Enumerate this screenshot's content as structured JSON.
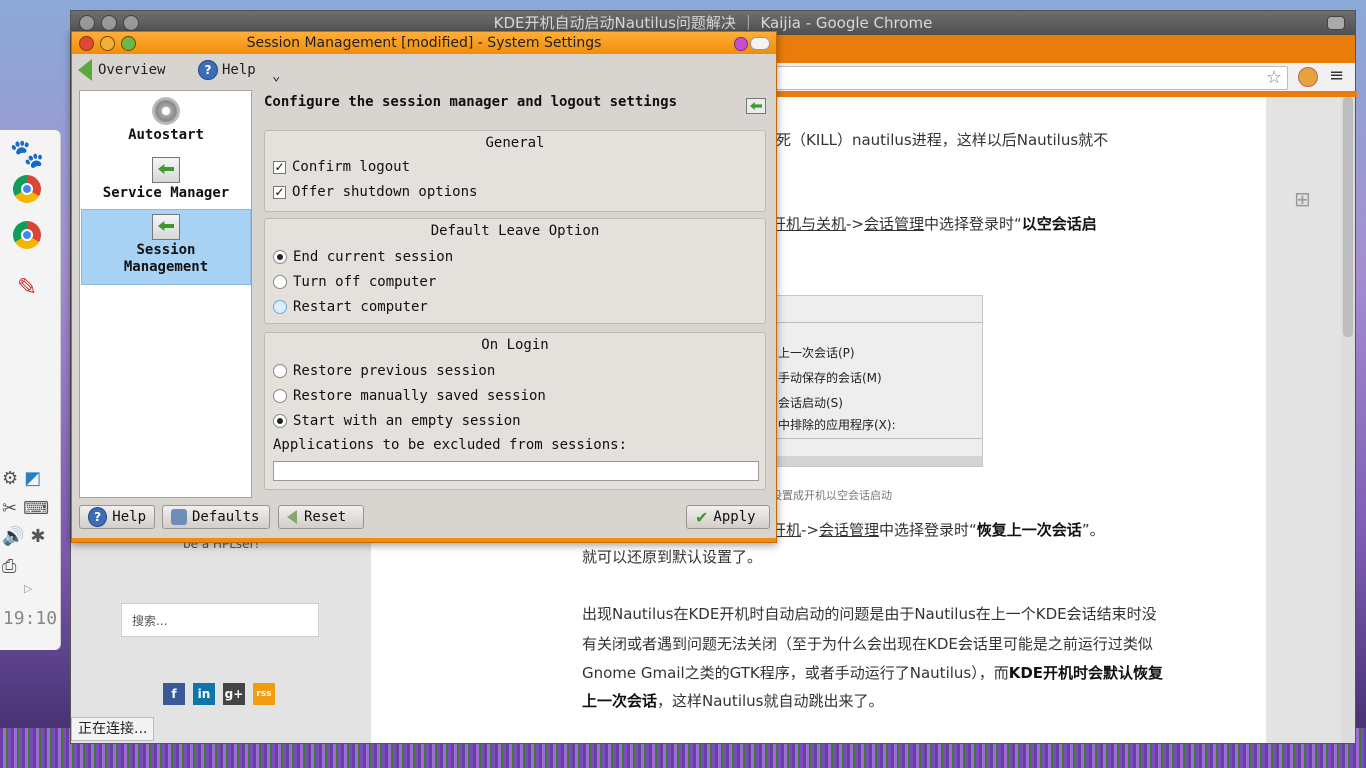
{
  "chrome": {
    "title": "KDE开机自动启动Nautilus问题解决 ｜ Kaijia - Google Chrome",
    "status": "正在连接..."
  },
  "article": {
    "p1": "死（KILL）nautilus进程，这样以后Nautilus就不",
    "p2_a": "开机与关机",
    "p2_b": "->",
    "p2_c": "会话管理",
    "p2_d": "中选择登录时“",
    "p2_e": "以空会话启",
    "shot_lines": [
      "上一次会话(P)",
      "手动保存的会话(M)",
      "会话启动(S)",
      "中排除的应用程序(X):"
    ],
    "caption": "设置成开机以空会话启动",
    "p3_a": "开机",
    "p3_b": "->",
    "p3_c": "会话管理",
    "p3_d": "中选择登录时“",
    "p3_e": "恢复上一次会话",
    "p3_f": "”。",
    "p4": "就可以还原到默认设置了。",
    "p5_l1": "出现Nautilus在KDE开机时自动启动的问题是由于Nautilus在上一个KDE会话结束时没",
    "p5_l2": "有关闭或者遇到问题无法关闭（至于为什么会出现在KDE会话里可能是之前运行过类似",
    "p5_l3a": "Gnome Gmail之类的GTK程序，或者手动运行了Nautilus），而",
    "p5_l3b": "KDE开机时会默认恢复",
    "p5_l4a": "上一次会话",
    "p5_l4b": "，这样Nautilus就自动跳出来了。"
  },
  "sidebar_page": {
    "left_text": "be a HPLser!",
    "search_placeholder": "搜索...",
    "social": [
      "f",
      "in",
      "g+",
      "rss"
    ]
  },
  "dock": {
    "clock": "19:10"
  },
  "dialog": {
    "title": "Session Management [modified] - System Settings",
    "toolbar": {
      "overview": "Overview",
      "help": "Help",
      "more": "⌄"
    },
    "sidebar": [
      {
        "label": "Autostart"
      },
      {
        "label": "Service Manager"
      },
      {
        "label": "Session Management"
      }
    ],
    "heading": "Configure the session manager and logout settings",
    "general": {
      "title": "General",
      "confirm_logout": "Confirm logout",
      "offer_shutdown": "Offer shutdown options"
    },
    "leave": {
      "title": "Default Leave Option",
      "end_session": "End current session",
      "turn_off": "Turn off computer",
      "restart": "Restart computer"
    },
    "login": {
      "title": "On Login",
      "restore_prev": "Restore previous session",
      "restore_manual": "Restore manually saved session",
      "empty": "Start with an empty session",
      "exclude_label": "Applications to be excluded from sessions:",
      "exclude_value": ""
    },
    "buttons": {
      "help": "Help",
      "defaults": "Defaults",
      "reset": "Reset",
      "apply": "Apply"
    }
  }
}
